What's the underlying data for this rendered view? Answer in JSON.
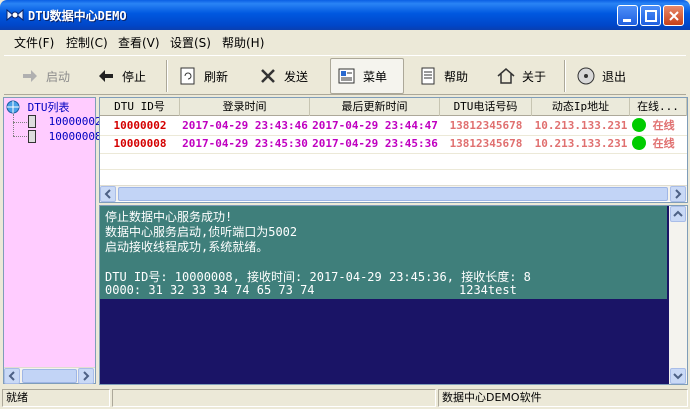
{
  "window": {
    "title": "DTU数据中心DEMO"
  },
  "menu": [
    {
      "label": "文件(F)"
    },
    {
      "label": "控制(C)"
    },
    {
      "label": "查看(V)"
    },
    {
      "label": "设置(S)"
    },
    {
      "label": "帮助(H)"
    }
  ],
  "toolbar": {
    "start": "启动",
    "stop": "停止",
    "refresh": "刷新",
    "send": "发送",
    "menu": "菜单",
    "help": "帮助",
    "about": "关于",
    "exit": "退出"
  },
  "tree": {
    "root": "DTU列表",
    "items": [
      "10000002",
      "10000008"
    ]
  },
  "grid": {
    "columns": [
      "DTU ID号",
      "登录时间",
      "最后更新时间",
      "DTU电话号码",
      "动态Ip地址",
      "在线..."
    ],
    "rows": [
      {
        "id": "10000002",
        "login": "2017-04-29 23:43:46",
        "updated": "2017-04-29 23:44:47",
        "phone": "13812345678",
        "ip": "10.213.133.231",
        "status": "在线"
      },
      {
        "id": "10000008",
        "login": "2017-04-29 23:45:30",
        "updated": "2017-04-29 23:45:36",
        "phone": "13812345678",
        "ip": "10.213.133.231",
        "status": "在线"
      }
    ]
  },
  "log": {
    "lines": [
      "停止数据中心服务成功!",
      "数据中心服务启动,侦听端口为5002",
      "启动接收线程成功,系统就绪。",
      "",
      "DTU ID号: 10000008, 接收时间: 2017-04-29 23:45:36, 接收长度: 8",
      "0000: 31 32 33 34 74 65 73 74                    1234test"
    ]
  },
  "status": {
    "left": "就绪",
    "right": "数据中心DEMO软件"
  },
  "colors": {
    "id_text": "#d40000",
    "time_text": "#c000c0",
    "phone_text": "#e07070",
    "online_dot": "#00cc00",
    "log_top_bg": "#3f7f7b",
    "log_bottom_bg": "#1a1466",
    "tree_bg": "#ffccff"
  }
}
